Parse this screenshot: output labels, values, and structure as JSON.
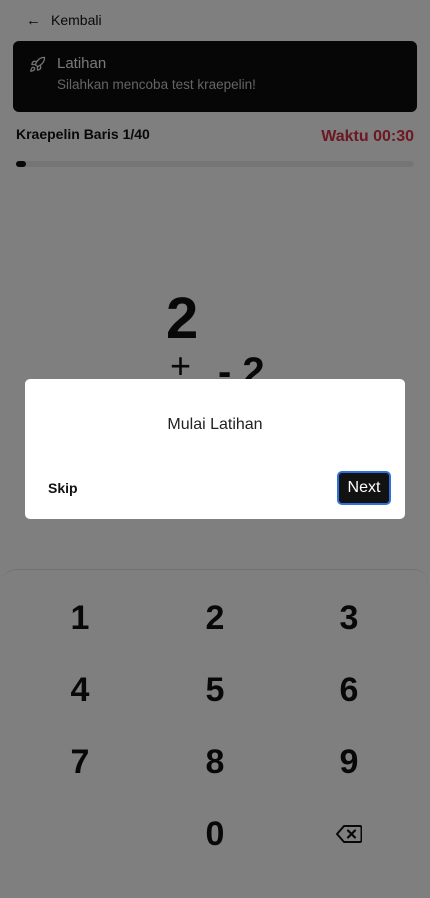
{
  "header": {
    "back_label": "Kembali"
  },
  "alert": {
    "title": "Latihan",
    "description": "Silahkan mencoba test kraepelin!"
  },
  "status": {
    "row_label": "Kraepelin Baris 1/40",
    "timer": "Waktu 00:30",
    "progress": 0.025
  },
  "question": {
    "top_number": "2",
    "operator": "+",
    "bottom_fragment": "- 2"
  },
  "keypad": {
    "keys": [
      "1",
      "2",
      "3",
      "4",
      "5",
      "6",
      "7",
      "8",
      "9",
      "0"
    ],
    "backspace_icon": "backspace-icon"
  },
  "modal": {
    "title": "Mulai Latihan",
    "skip_label": "Skip",
    "next_label": "Next"
  },
  "colors": {
    "timer": "#d93045",
    "accent_border": "#2f6fe0",
    "dark": "#0c0c0e"
  }
}
